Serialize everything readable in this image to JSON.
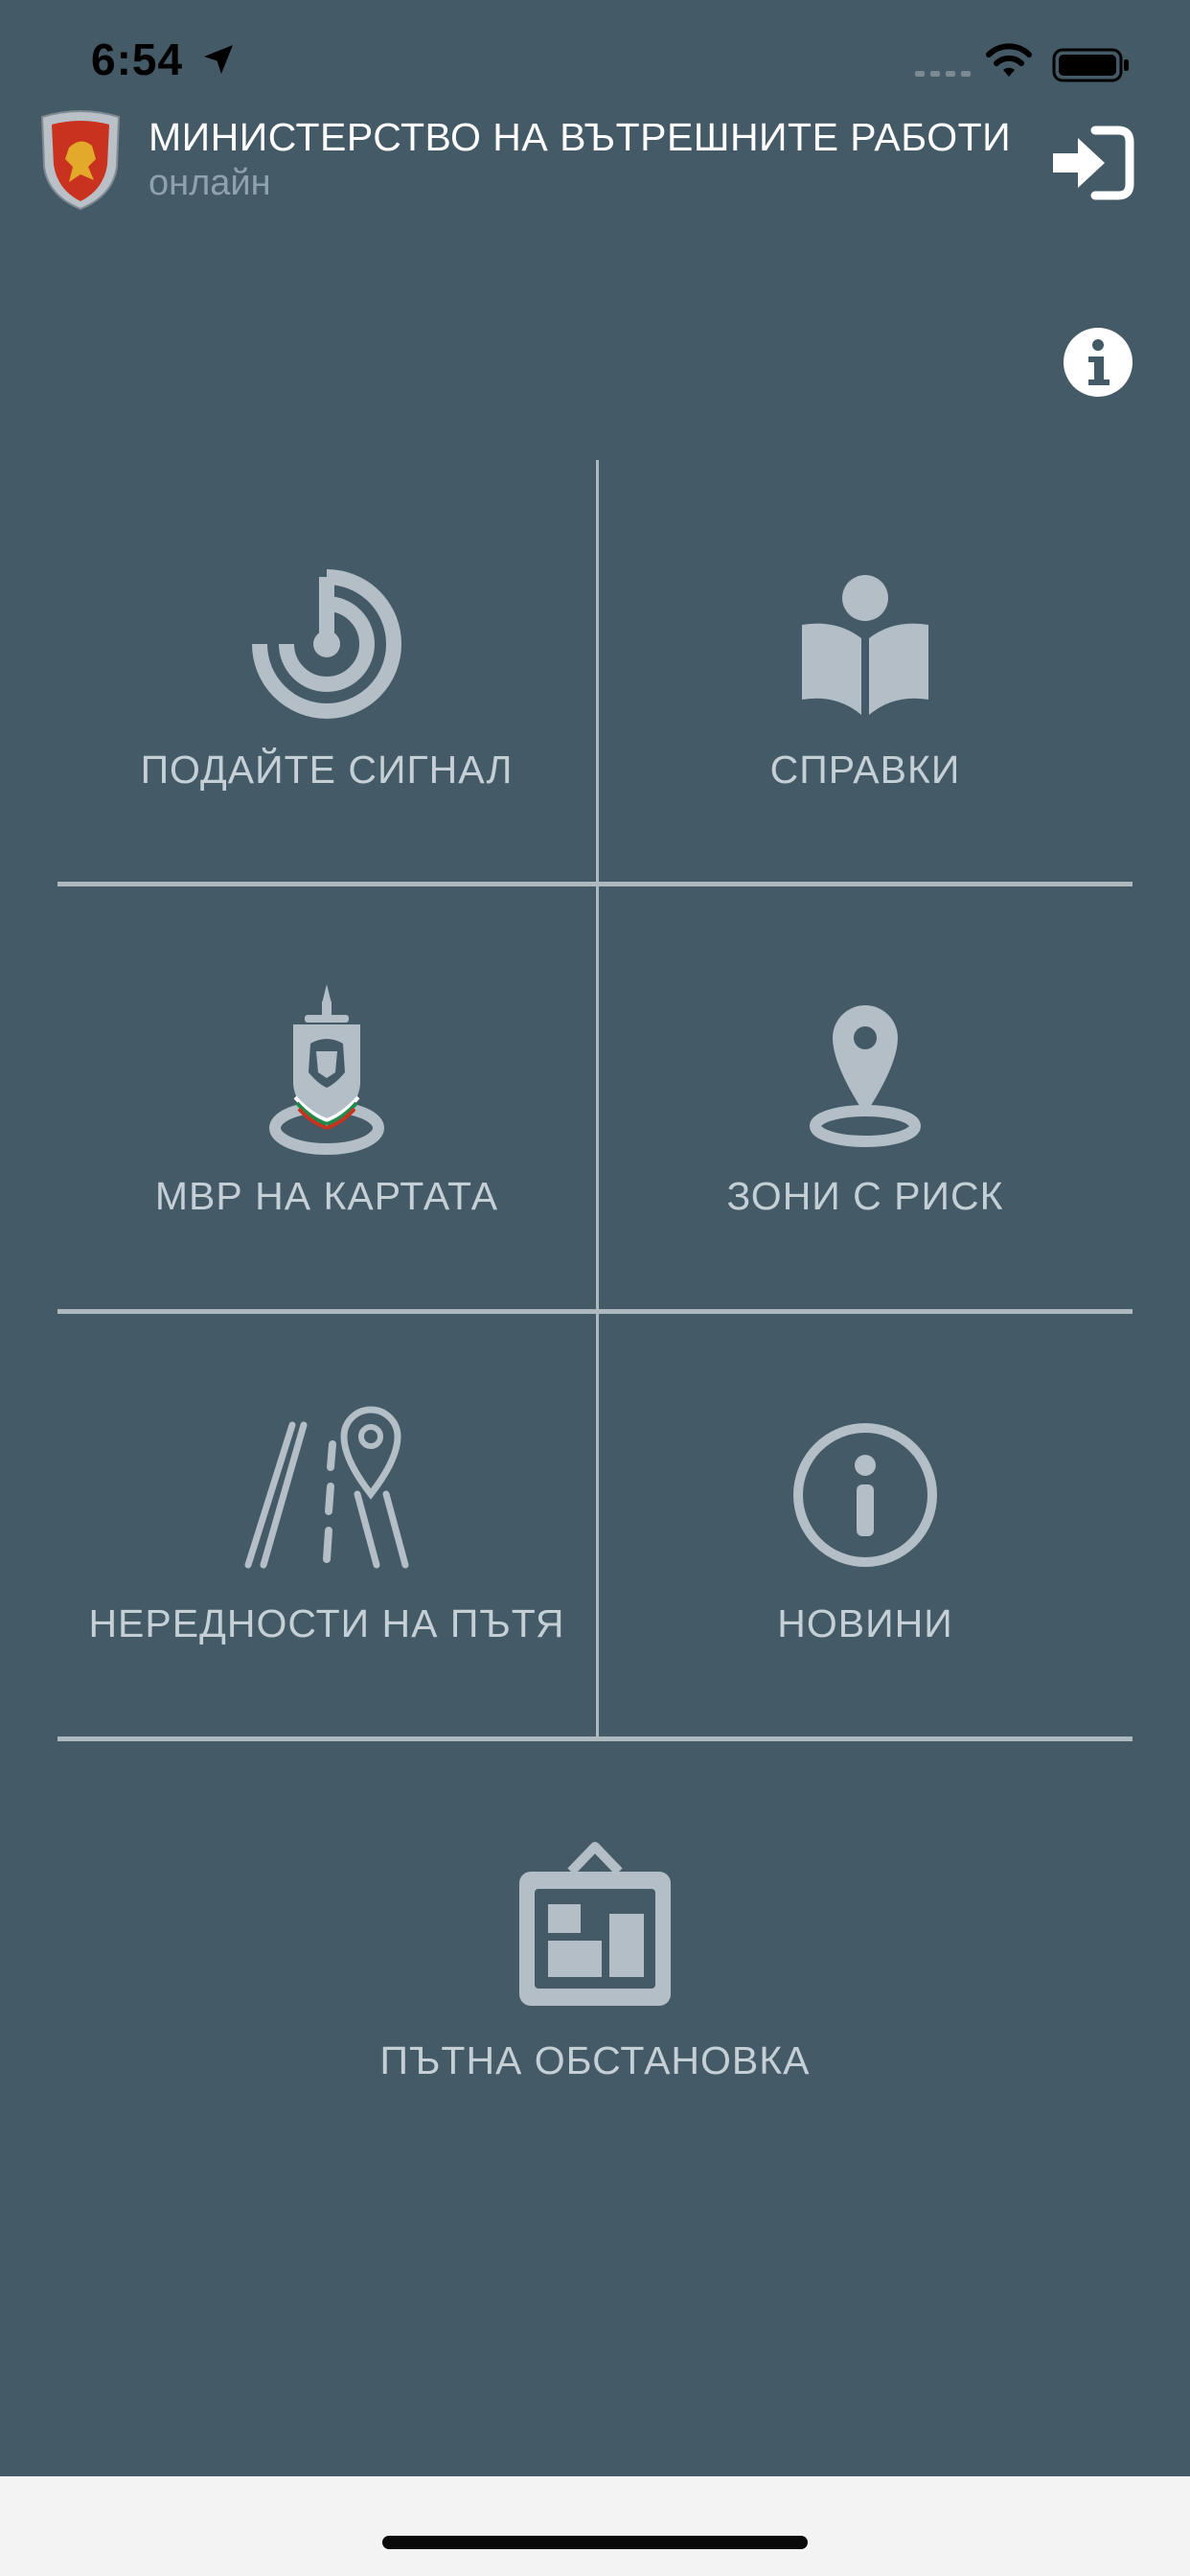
{
  "status_bar": {
    "time": "6:54"
  },
  "header": {
    "title": "МИНИСТЕРСТВО НА ВЪТРЕШНИТЕ РАБОТИ",
    "status": "онлайн",
    "logo_icon": "coat-of-arms-shield-icon",
    "logout_icon": "sign-in-arrow-icon"
  },
  "info_icon": "info-circle-icon",
  "menu": {
    "items": [
      {
        "label": "ПОДАЙТЕ СИГНАЛ",
        "icon": "radar-target-icon"
      },
      {
        "label": "СПРАВКИ",
        "icon": "person-reading-book-icon"
      },
      {
        "label": "МВР НА КАРТАТА",
        "icon": "mvr-emblem-map-pin-icon"
      },
      {
        "label": "ЗОНИ С РИСК",
        "icon": "map-pin-icon"
      },
      {
        "label": "НЕРЕДНОСТИ НА ПЪТЯ",
        "icon": "road-location-icon"
      },
      {
        "label": "НОВИНИ",
        "icon": "info-circle-icon"
      },
      {
        "label": "ПЪТНА ОБСТАНОВКА",
        "icon": "traffic-board-icon"
      }
    ]
  },
  "colors": {
    "background": "#445a67",
    "icon": "#b3bec6",
    "label": "#c4cfd6",
    "divider": "#aeb8bf"
  }
}
